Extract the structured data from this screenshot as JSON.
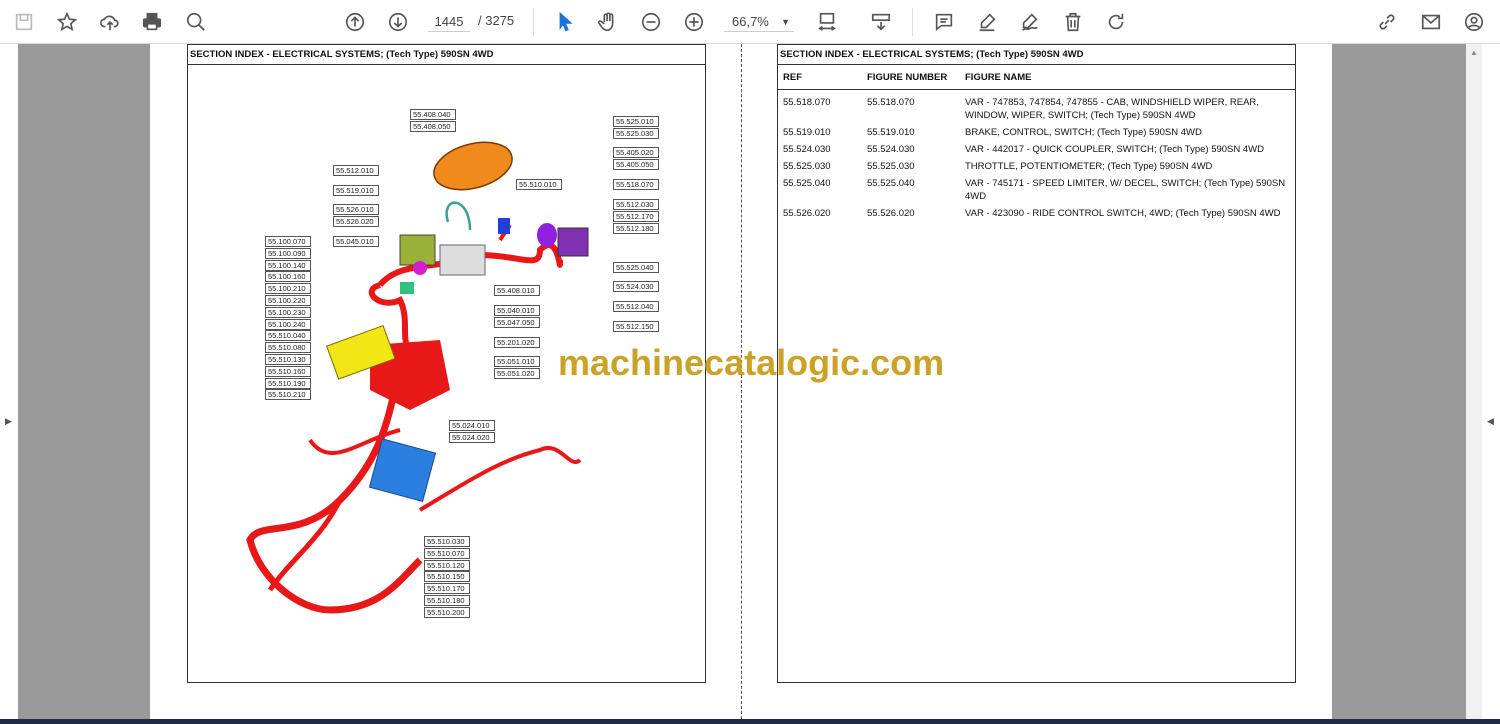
{
  "toolbar": {
    "page_current": "1445",
    "page_total": "/ 3275",
    "zoom": "66,7%",
    "icons": [
      "save-icon",
      "bookmark-star-icon",
      "upload-cloud-icon",
      "print-icon",
      "search-zoom-icon",
      "page-up-icon",
      "page-down-icon",
      "select-cursor-icon",
      "hand-pan-icon",
      "zoom-out-icon",
      "zoom-in-icon",
      "fit-page-icon",
      "scroll-mode-icon",
      "comment-icon",
      "highlight-icon",
      "sign-icon",
      "delete-icon",
      "rotate-icon",
      "share-link-icon",
      "mail-icon",
      "account-icon"
    ]
  },
  "left_page": {
    "title": "SECTION INDEX - ELECTRICAL SYSTEMS; (Tech Type) 590SN 4WD",
    "callouts": [
      "55.408.040",
      "55.408.050",
      "55.512.010",
      "55.519.010",
      "55.526.010",
      "55.526.020",
      "55.045.010",
      "55.100.070",
      "55.100.090",
      "55.100.140",
      "55.100.160",
      "55.100.210",
      "55.100.220",
      "55.100.230",
      "55.100.240",
      "55.510.040",
      "55.510.080",
      "55.510.130",
      "55.510.160",
      "55.510.190",
      "55.510.210",
      "55.510.010",
      "55.525.010",
      "55.525.030",
      "55.405.020",
      "55.405.050",
      "55.518.070",
      "55.512.030",
      "55.512.170",
      "55.512.180",
      "55.525.040",
      "55.524.030",
      "55.512.040",
      "55.512.150",
      "55.408.010",
      "55.040.010",
      "55.047.050",
      "55.201.020",
      "55.051.010",
      "55.051.020",
      "55.024.010",
      "55.024.020",
      "55.510.030",
      "55.510.070",
      "55.510.120",
      "55.510.150",
      "55.510.170",
      "55.510.180",
      "55.510.200"
    ]
  },
  "right_page": {
    "title": "SECTION INDEX - ELECTRICAL SYSTEMS; (Tech Type) 590SN 4WD",
    "headers": [
      "REF",
      "FIGURE NUMBER",
      "FIGURE NAME"
    ],
    "rows": [
      [
        "55.518.070",
        "55.518.070",
        "VAR - 747853, 747854, 747855 - CAB, WINDSHIELD WIPER, REAR, WINDOW, WIPER, SWITCH; (Tech Type) 590SN 4WD"
      ],
      [
        "55.519.010",
        "55.519.010",
        "BRAKE, CONTROL, SWITCH; (Tech Type) 590SN 4WD"
      ],
      [
        "55.524.030",
        "55.524.030",
        "VAR - 442017 - QUICK COUPLER, SWITCH; (Tech Type) 590SN 4WD"
      ],
      [
        "55.525.030",
        "55.525.030",
        "THROTTLE, POTENTIOMETER; (Tech Type) 590SN 4WD"
      ],
      [
        "55.525.040",
        "55.525.040",
        "VAR - 745171 - SPEED LIMITER, W/ DECEL, SWITCH; (Tech Type) 590SN 4WD"
      ],
      [
        "55.526.020",
        "55.526.020",
        "VAR - 423090 - RIDE CONTROL SWITCH, 4WD; (Tech Type) 590SN 4WD"
      ]
    ]
  },
  "watermark": "machinecatalogic.com"
}
